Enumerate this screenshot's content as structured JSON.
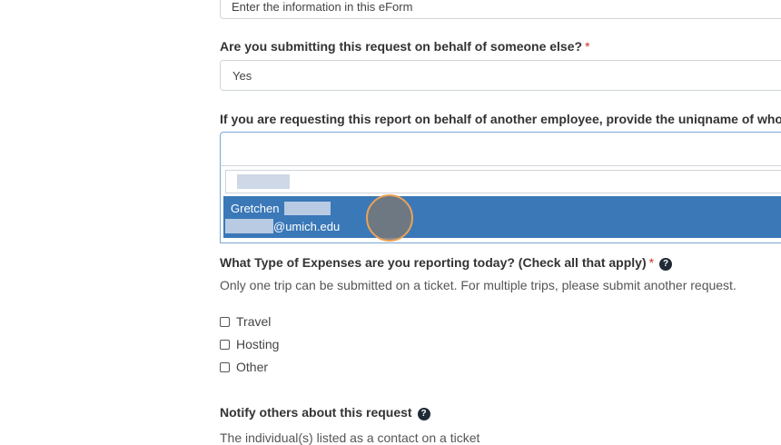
{
  "entry_method": {
    "value": "Enter the information in this eForm"
  },
  "behalf": {
    "question": "Are you submitting this request on behalf of someone else?",
    "required_mark": "*",
    "value": "Yes"
  },
  "uniqname": {
    "question": "If you are requesting this report on behalf of another employee, provide the uniqname of who",
    "search_value": "",
    "dropdown": {
      "filter_value": "",
      "selected_option": {
        "name": "Gretchen",
        "email_suffix": "@umich.edu"
      }
    }
  },
  "expenses": {
    "question": "What Type of Expenses are you reporting today? (Check all that apply)",
    "required_mark": "*",
    "help_icon": "?",
    "description": "Only one trip can be submitted on a ticket. For multiple trips, please submit another request.",
    "options": [
      "Travel",
      "Hosting",
      "Other"
    ]
  },
  "notify": {
    "question": "Notify others about this request",
    "help_icon": "?",
    "description": "The individual(s) listed as a contact on a ticket"
  },
  "colors": {
    "selected_option_bg": "#3a78b8",
    "focus_border": "#7aa7d4",
    "required": "#c9302c"
  }
}
